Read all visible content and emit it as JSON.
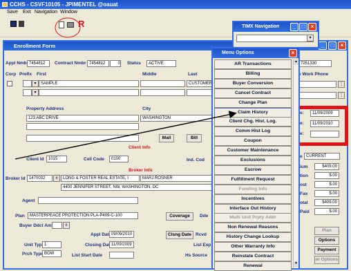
{
  "app": {
    "title": "CCHS - CSVF10105 - JPIMENTEL @oauat",
    "menu": [
      "Save",
      "Exit",
      "Navigation",
      "Window"
    ],
    "toolbar_red_letter": "R"
  },
  "timx": {
    "title": "TIMX Navigation"
  },
  "enrollment": {
    "title": "Enrollment Form",
    "appl_label": "Appl Nmbr",
    "appl_value": "7454812",
    "contract_label": "Contract Nmbr",
    "contract_value": "7454812",
    "contract_suffix": "0",
    "status_label": "Status",
    "status_value": "ACTIVE",
    "corp_label": "Corp",
    "prefix_label": "Prefix",
    "first_label": "First",
    "middle_label": "Middle",
    "last_label": "Last",
    "first_value": "SAMPLE",
    "last_value": "CUSTOMER",
    "work_phone_label": "e Work Phone",
    "right_id_value": "7251330",
    "property_address_label": "Property Address",
    "city_label": "City",
    "address_value": "123 ABC DRIVE",
    "city_value": "WASHINGTON",
    "mail_btn": "Mail",
    "bill_btn": "Bill",
    "client_info": "Client Info",
    "client_id_label": "Client Id",
    "client_id_value": "1015",
    "cell_code_label": "Cell Code",
    "cell_code_value": "0100",
    "ind_code_label": "Ind. Cod",
    "broker_info": "Broker Info",
    "broker_id_label": "Broker Id",
    "broker_id_value": "1470032",
    "broker_name_value": "LONG & FOSTER REAL ESTATE, I",
    "broker_agent_value": "MARJ ROSNER",
    "broker_address_value": "4400 JENNIFER STREET, NW, WASHINGTON, DC",
    "agent_label": "Agent",
    "plan_label": "Plan",
    "plan_value": "MASTERPEACE PROTECTION PLA-P409-C-100",
    "coverage_btn": "Coverage",
    "dde_label": "Dde",
    "buyer_label": "Buyer Ddct Amt",
    "appl_date_label": "Appl Date",
    "appl_date_value": "09/09/2010",
    "clsng_date_btn": "Clsng Date",
    "rcvd_label": "Rcvd",
    "unit_type_label": "Unit Type",
    "unit_type_value": "1",
    "closing_date_label": "Closing Date",
    "closing_date_value": "11/09/2009",
    "list_exp_label": "List Exp",
    "prch_type_label": "Prch Type",
    "prch_type_value": "BOW",
    "list_start_label": "List Start Date",
    "hs_source_label": "Hs Source",
    "date1_label": "e:",
    "date1_value": "11/09/2009",
    "date2_label": "e:",
    "date2_value": "11/09/2010",
    "date3_label": "e:",
    "current_label": "e",
    "current_value": "CURRENT",
    "right_labels": [
      "ium",
      "tion",
      "ost",
      "Fax",
      "otal",
      "Paid"
    ],
    "right_values": [
      "$409.00",
      "$.00",
      "$.00",
      "$.00",
      "$409.00",
      "$.00"
    ],
    "plan_btn": "Plan",
    "options_btn": "Options",
    "payment_btn": "Payment",
    "user_options_btn": "er Options"
  },
  "menu_options": {
    "title": "Menu Options",
    "items": [
      {
        "label": "AR Transactions",
        "enabled": true
      },
      {
        "label": "Billing",
        "enabled": true
      },
      {
        "label": "Buyer Conversion",
        "enabled": true
      },
      {
        "label": "Cancel Contract",
        "enabled": true
      },
      {
        "label": "Change Plan",
        "enabled": true
      },
      {
        "label": "Claim History",
        "enabled": true
      },
      {
        "label": "Client Chg. Hist. Log.",
        "enabled": true
      },
      {
        "label": "Comm Hist Log",
        "enabled": true
      },
      {
        "label": "Coupon",
        "enabled": true
      },
      {
        "label": "Customer Maintenance",
        "enabled": true
      },
      {
        "label": "Exclusions",
        "enabled": true
      },
      {
        "label": "Escrow",
        "enabled": true
      },
      {
        "label": "Fulfillment Request",
        "enabled": true
      },
      {
        "label": "Funding Info",
        "enabled": false
      },
      {
        "label": "Incentives",
        "enabled": true
      },
      {
        "label": "Interface Out History",
        "enabled": true
      },
      {
        "label": "Multi Unit Prpty Addr",
        "enabled": false
      },
      {
        "label": "Non Renewal Reasons",
        "enabled": true
      },
      {
        "label": "History Change Lookup",
        "enabled": true
      },
      {
        "label": "Other Warranty Info",
        "enabled": true
      },
      {
        "label": "Reinstate Contract",
        "enabled": true
      },
      {
        "label": "Renewal",
        "enabled": true
      }
    ]
  },
  "colors": {
    "highlight_box": "#e0141a",
    "title_blue": "#1c53c8",
    "form_bg": "#ece9d8"
  }
}
